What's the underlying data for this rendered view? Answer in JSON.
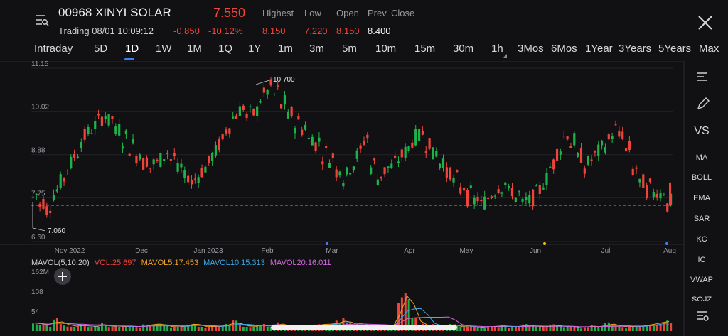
{
  "header": {
    "symbol": "00968 XINYI SOLAR",
    "price": "7.550",
    "trading": "Trading 08/01 10:09:12",
    "change": "-0.850",
    "change_pct": "-10.12%",
    "stats_labels": [
      "Highest",
      "Low",
      "Open",
      "Prev. Close"
    ],
    "stats_values": [
      "8.150",
      "7.220",
      "8.150",
      "8.400"
    ]
  },
  "tabs": [
    "Intraday",
    "5D",
    "1D",
    "1W",
    "1M",
    "1Q",
    "1Y",
    "1m",
    "3m",
    "5m",
    "10m",
    "15m",
    "30m",
    "1h",
    "3Mos",
    "6Mos",
    "1Year",
    "3Years",
    "5Years",
    "Max"
  ],
  "active_tab": "1D",
  "right_menu": [
    "VS",
    "MA",
    "BOLL",
    "EMA",
    "SAR",
    "KC",
    "IC",
    "VWAP",
    "SOJZ"
  ],
  "colors": {
    "up": "#1db34a",
    "down": "#f0433a",
    "bg": "#111114",
    "accent": "#3b82f6"
  },
  "chart_data": {
    "type": "candlestick",
    "y_ticks": [
      "11.15",
      "10.02",
      "8.88",
      "7.75",
      "6.60"
    ],
    "ylim": [
      6.6,
      11.15
    ],
    "x_ticks": [
      "Nov 2022",
      "Dec",
      "Jan 2023",
      "Feb",
      "Mar",
      "Apr",
      "May",
      "Jun",
      "Jul",
      "Aug"
    ],
    "annotations": {
      "high": "10.700",
      "low": "7.060"
    },
    "reference_line": 7.55,
    "price_series": [
      7.8,
      7.6,
      7.5,
      7.9,
      8.2,
      8.6,
      8.9,
      9.3,
      9.5,
      9.7,
      9.9,
      9.8,
      9.5,
      9.3,
      9.1,
      8.9,
      8.7,
      8.6,
      8.7,
      8.9,
      8.8,
      8.5,
      8.3,
      8.2,
      8.4,
      8.6,
      8.9,
      9.2,
      9.6,
      9.9,
      10.1,
      9.9,
      10.0,
      10.4,
      10.6,
      10.5,
      10.2,
      9.9,
      9.7,
      9.6,
      9.3,
      9.2,
      8.9,
      8.8,
      8.5,
      8.3,
      8.6,
      8.9,
      9.3,
      8.6,
      8.3,
      8.5,
      8.6,
      8.8,
      9.0,
      9.3,
      9.4,
      9.2,
      8.9,
      8.7,
      8.4,
      8.2,
      8.0,
      7.8,
      7.7,
      7.6,
      7.8,
      8.0,
      8.1,
      7.9,
      7.8,
      7.6,
      7.7,
      7.9,
      8.2,
      8.6,
      9.0,
      9.4,
      9.2,
      8.8,
      8.6,
      8.8,
      9.0,
      9.2,
      9.5,
      9.4,
      9.0,
      8.5,
      8.1,
      8.0,
      7.9,
      7.9,
      7.6
    ],
    "volume_ticks": [
      "162M",
      "108",
      "54"
    ],
    "volume_series": [
      22,
      18,
      16,
      30,
      20,
      15,
      12,
      18,
      10,
      14,
      20,
      12,
      9,
      14,
      12,
      10,
      16,
      18,
      20,
      14,
      10,
      12,
      15,
      22,
      13,
      11,
      14,
      12,
      20,
      24,
      16,
      12,
      14,
      18,
      10,
      22,
      16,
      12,
      10,
      9,
      14,
      16,
      20,
      18,
      24,
      30,
      18,
      14,
      12,
      10,
      16,
      12,
      14,
      80,
      110,
      36,
      18,
      14,
      16,
      12,
      20,
      14,
      10,
      12,
      9,
      8,
      14,
      12,
      16,
      10,
      12,
      18,
      14,
      12,
      10,
      16,
      14,
      12,
      9,
      10,
      12,
      14,
      10,
      22,
      16,
      12,
      10,
      14,
      12,
      20,
      18,
      28,
      24
    ],
    "mavol_legend": {
      "title": "MAVOL(5,10,20)",
      "vol": "VOL:25.697",
      "ma5": "MAVOL5:17.453",
      "ma10": "MAVOL10:15.313",
      "ma20": "MAVOL20:16.011"
    }
  }
}
